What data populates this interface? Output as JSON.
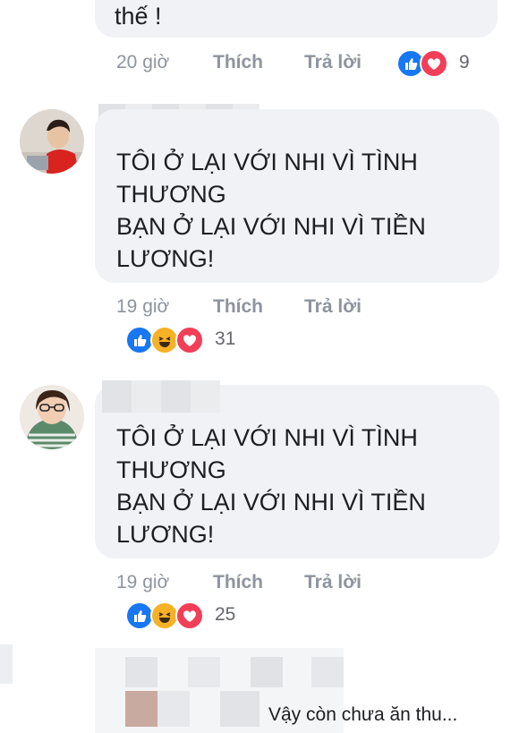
{
  "comments": [
    {
      "text": "thế !",
      "time": "20 giờ",
      "like_label": "Thích",
      "reply_label": "Trả lời",
      "reaction_count": "9",
      "reactions": [
        "like-icon",
        "love-icon"
      ]
    },
    {
      "text": "TÔI Ở LẠI VỚI NHI VÌ TÌNH\nTHƯƠNG\nBẠN Ở LẠI VỚI NHI VÌ TIỀN\nLƯƠNG!",
      "time": "19 giờ",
      "like_label": "Thích",
      "reply_label": "Trả lời",
      "reaction_count": "31",
      "reactions": [
        "like-icon",
        "haha-icon",
        "love-icon"
      ]
    },
    {
      "text": "TÔI Ở LẠI VỚI NHI VÌ TÌNH\nTHƯƠNG\nBẠN Ở LẠI VỚI NHI VÌ TIỀN\nLƯƠNG!",
      "time": "19 giờ",
      "like_label": "Thích",
      "reply_label": "Trả lời",
      "reaction_count": "25",
      "reactions": [
        "like-icon",
        "haha-icon",
        "love-icon"
      ]
    }
  ],
  "bottom_reply": {
    "text": "Vậy còn chưa ăn thu..."
  },
  "colors": {
    "like": "#1877f2",
    "love": "#f33e58",
    "haha": "#f7b125",
    "bubble": "#f0f2f5",
    "meta": "#8d949e"
  }
}
